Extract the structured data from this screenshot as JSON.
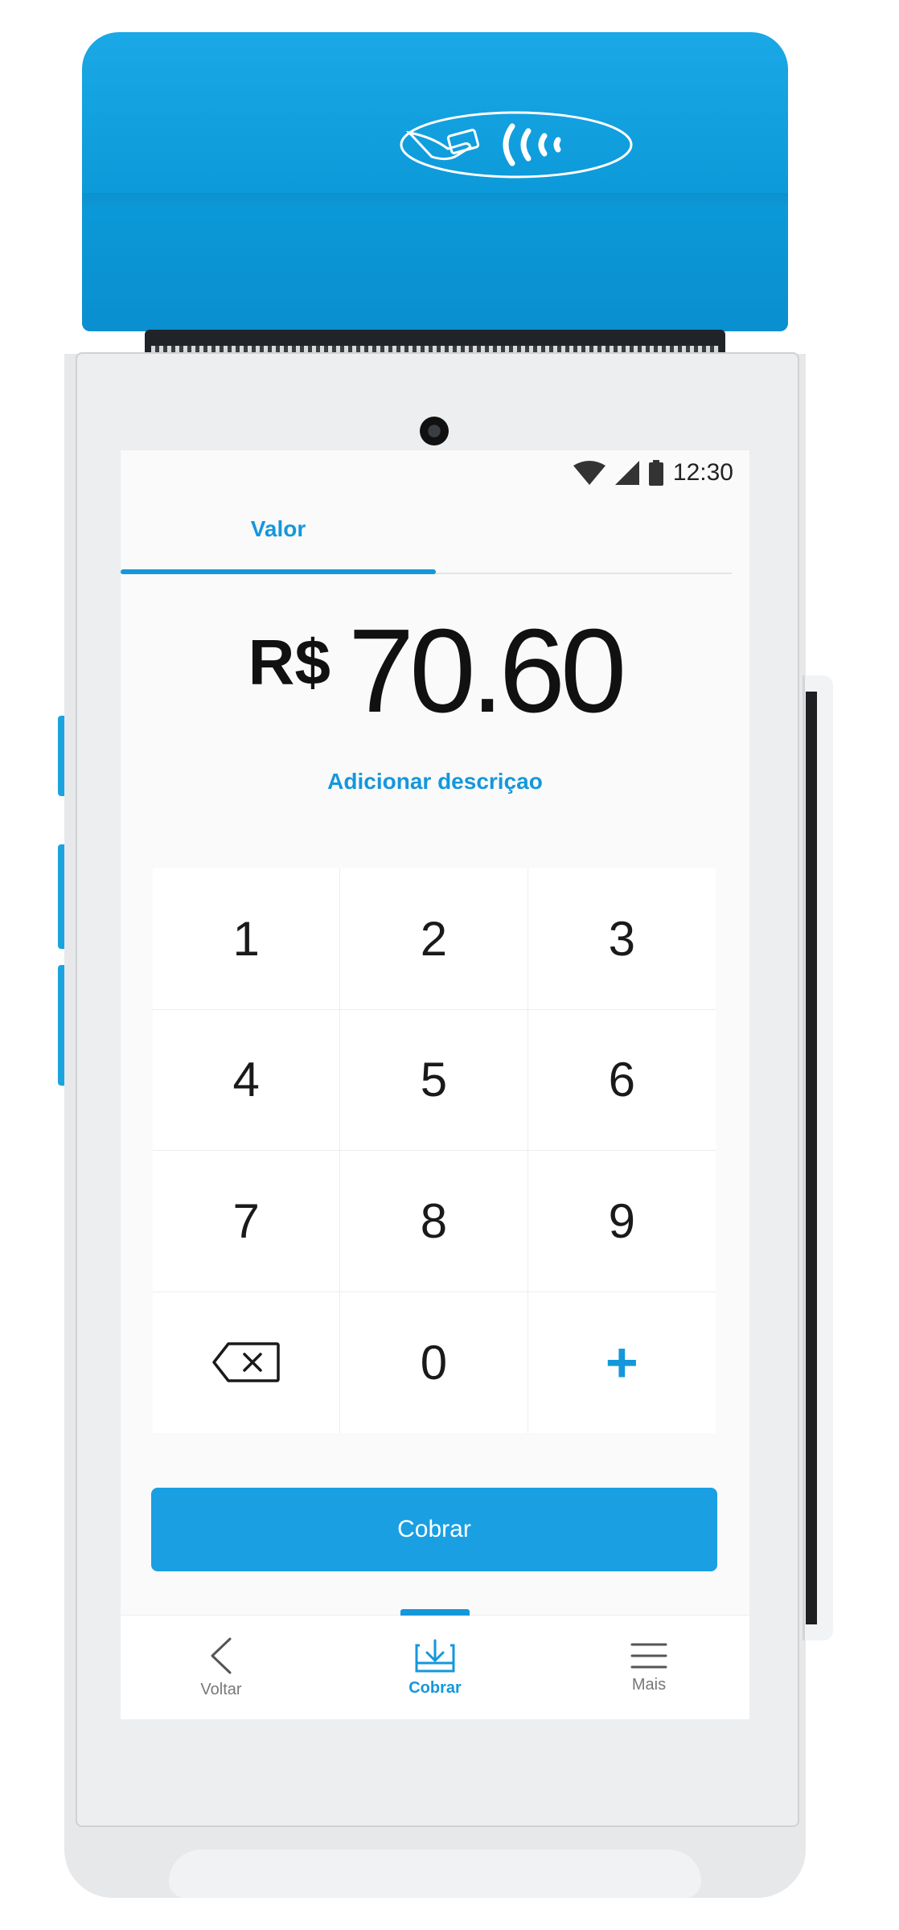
{
  "status_bar": {
    "time": "12:30",
    "icons": [
      "wifi-icon",
      "signal-icon",
      "battery-icon"
    ]
  },
  "tabs": [
    {
      "label": "Valor",
      "active": true
    }
  ],
  "amount": {
    "currency": "R$",
    "value": "70.60"
  },
  "add_description_label": "Adicionar descriçao",
  "keypad": {
    "keys": [
      "1",
      "2",
      "3",
      "4",
      "5",
      "6",
      "7",
      "8",
      "9"
    ],
    "zero": "0",
    "backspace_icon": "backspace-icon",
    "plus": "+"
  },
  "primary_action": {
    "label": "Cobrar"
  },
  "bottom_nav": [
    {
      "label": "Voltar",
      "icon": "chevron-left-icon",
      "active": false
    },
    {
      "label": "Cobrar",
      "icon": "download-tray-icon",
      "active": true
    },
    {
      "label": "Mais",
      "icon": "menu-icon",
      "active": false
    }
  ],
  "colors": {
    "accent": "#1597db",
    "device_cap": "#0b98d8",
    "button": "#1a9fe2"
  }
}
